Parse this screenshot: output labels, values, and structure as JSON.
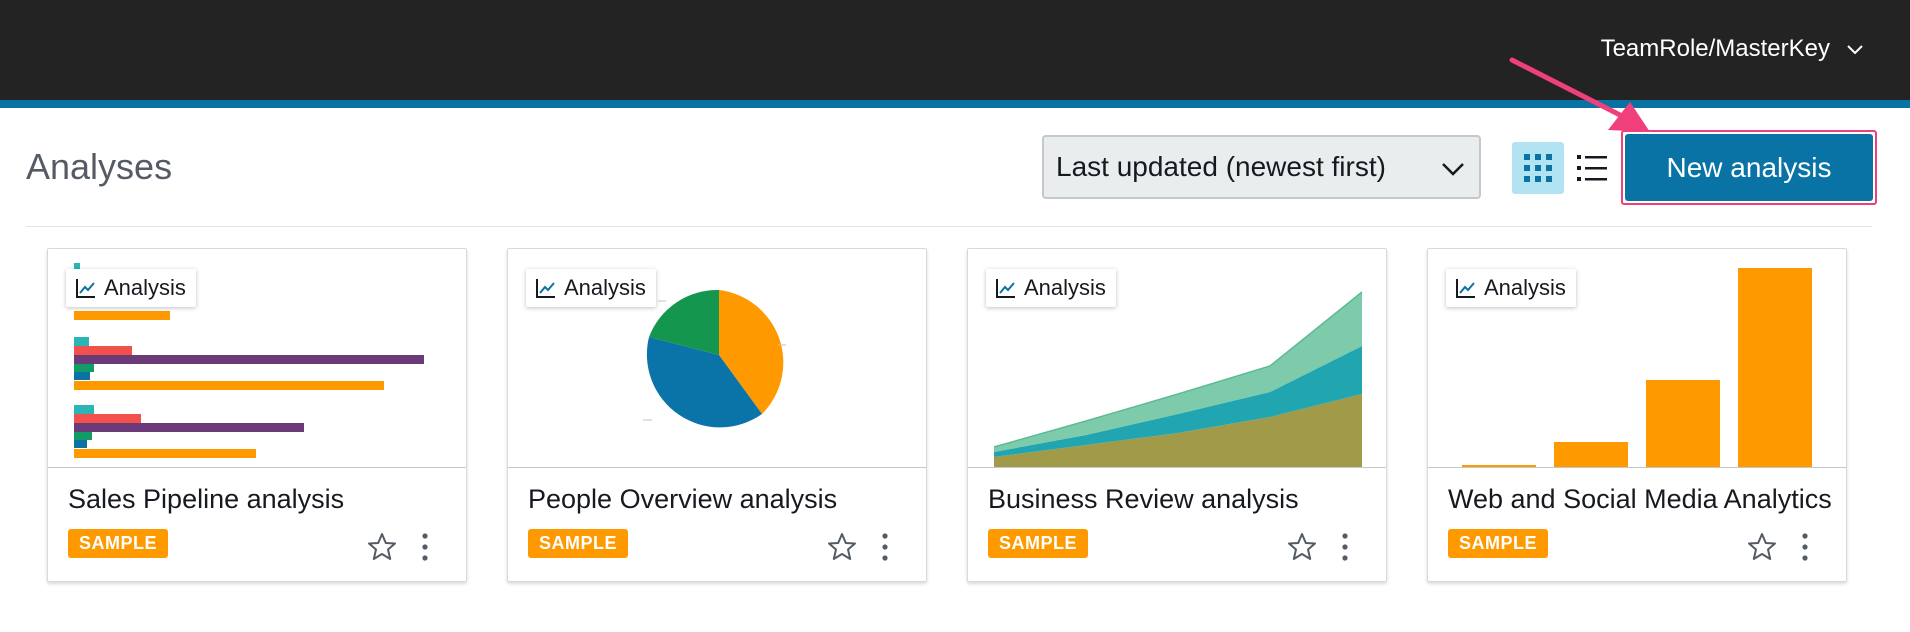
{
  "header": {
    "user_menu_label": "TeamRole/MasterKey",
    "brand_bar_color": "#232323",
    "accent_color": "#0873a3"
  },
  "toolbar": {
    "page_title": "Analyses",
    "sort_value": "Last updated (newest first)",
    "new_button_label": "New analysis",
    "view_grid_icon": "grid-view-icon",
    "view_list_icon": "list-view-icon"
  },
  "cards": [
    {
      "title": "Sales Pipeline analysis",
      "type_label": "Analysis",
      "tag": "SAMPLE"
    },
    {
      "title": "People Overview analysis",
      "type_label": "Analysis",
      "tag": "SAMPLE"
    },
    {
      "title": "Business Review analysis",
      "type_label": "Analysis",
      "tag": "SAMPLE"
    },
    {
      "title": "Web and Social Media Analytics",
      "type_label": "Analysis",
      "tag": "SAMPLE"
    }
  ],
  "colors": {
    "primary_button": "#0a73a5",
    "sample_tag": "#ff9900",
    "highlight_frame": "#f0407b"
  }
}
